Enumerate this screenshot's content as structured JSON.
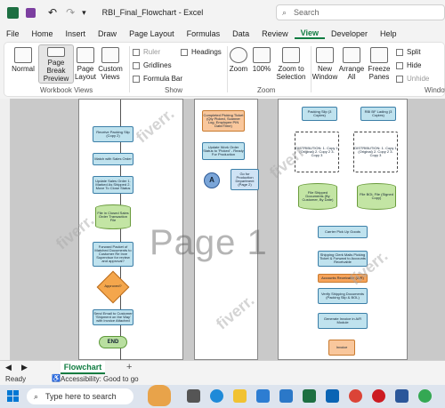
{
  "titlebar": {
    "autosave": "On",
    "file_title": "RBI_Final_Flowchart  -  Excel",
    "search_placeholder": "Search"
  },
  "menu": [
    "File",
    "Home",
    "Insert",
    "Draw",
    "Page Layout",
    "Formulas",
    "Data",
    "Review",
    "View",
    "Developer",
    "Help"
  ],
  "ribbon": {
    "normal": "Normal",
    "page_break_preview": "Page Break Preview",
    "page_layout": "Page Layout",
    "custom_views": "Custom Views",
    "workbook_views_label": "Workbook Views",
    "ruler": "Ruler",
    "gridlines": "Gridlines",
    "formula_bar": "Formula Bar",
    "headings": "Headings",
    "show_label": "Show",
    "zoom": "Zoom",
    "zoom_100": "100%",
    "zoom_to_selection": "Zoom to Selection",
    "zoom_label": "Zoom",
    "new_window": "New Window",
    "arrange_all": "Arrange All",
    "freeze_panes": "Freeze Panes",
    "split": "Split",
    "hide": "Hide",
    "unhide": "Unhide",
    "window_label": "Window"
  },
  "sheet": {
    "page_watermark": "Page 1",
    "flow_left": [
      "Receive Packing Slip (Copy 2)",
      "Match with Sales Order",
      "Update Sales Order 1. Marked As Shipped 2. Move To Close Status",
      "File in Closed Sales Order Transaction File",
      "Forward Packet of Matched Documents to Customer Re Inve Supervisor for review and approval?",
      "Approved?",
      "Send Email to Customer 'Shipment on the Way' with Invoice Attached",
      "END"
    ],
    "flow_middle": [
      "Completed Picking Ticket (Qty Picked, Scanner Log, Employee PIN Date/Time)",
      "Update Work Order Status to 'Picked' - Ready For Production",
      "A",
      "Go for Production Department (Page 2)"
    ],
    "flow_right": [
      "Packing Slip (3 Copies)",
      "RBI BF Lading (3 Copies)",
      "DISTRIBUTION: 1. Copy 1 (Original) 2. Copy 2 3. Copy 3",
      "File Shipped Documents (By Customer, By Date)",
      "File BOL File (Signed Copy)",
      "Carrier Pick Up Goods",
      "Shipping Clerk Mails Picking Ticket & Forward to Accounts Receivable",
      "Accounts Receivable (A/R)",
      "Verify Shipping Documents (Packing Slip & BOL)",
      "Generate Invoice in A/R Module",
      "Invoice"
    ]
  },
  "sheet_tab": "Flowchart",
  "status": {
    "ready": "Ready",
    "accessibility": "Accessibility: Good to go"
  },
  "taskbar": {
    "search_placeholder": "Type here to search"
  },
  "watermark": "fiverr."
}
